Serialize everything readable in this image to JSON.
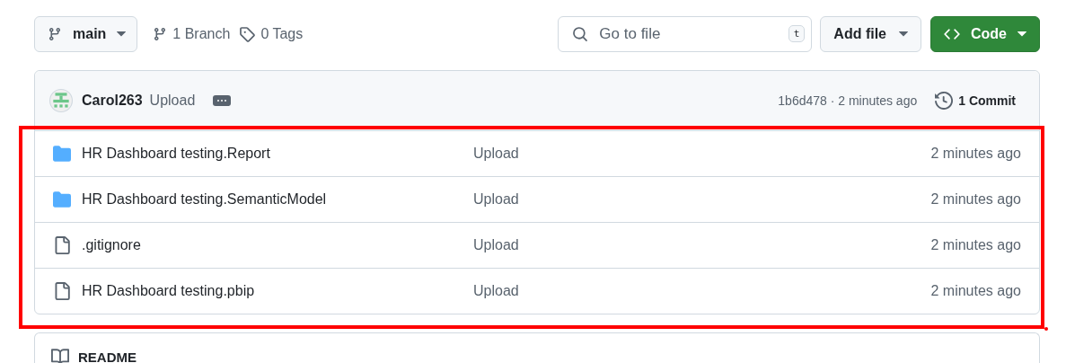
{
  "toolbar": {
    "branch": "main",
    "branches": "1 Branch",
    "tags": "0 Tags",
    "search": {
      "placeholder": "Go to file",
      "shortcut": "t"
    },
    "add_file": "Add file",
    "code": "Code"
  },
  "commit": {
    "author": "Carol263",
    "message": "Upload",
    "hash_time": "1b6d478 · 2 minutes ago",
    "commits": "1 Commit"
  },
  "files": {
    "highlighted": true,
    "rows": [
      {
        "kind": "folder",
        "name": "HR Dashboard testing.Report",
        "message": "Upload",
        "time": "2 minutes ago"
      },
      {
        "kind": "folder",
        "name": "HR Dashboard testing.SemanticModel",
        "message": "Upload",
        "time": "2 minutes ago"
      },
      {
        "kind": "file",
        "name": ".gitignore",
        "message": "Upload",
        "time": "2 minutes ago"
      },
      {
        "kind": "file",
        "name": "HR Dashboard testing.pbip",
        "message": "Upload",
        "time": "2 minutes ago"
      }
    ]
  },
  "readme": {
    "title": "README"
  }
}
